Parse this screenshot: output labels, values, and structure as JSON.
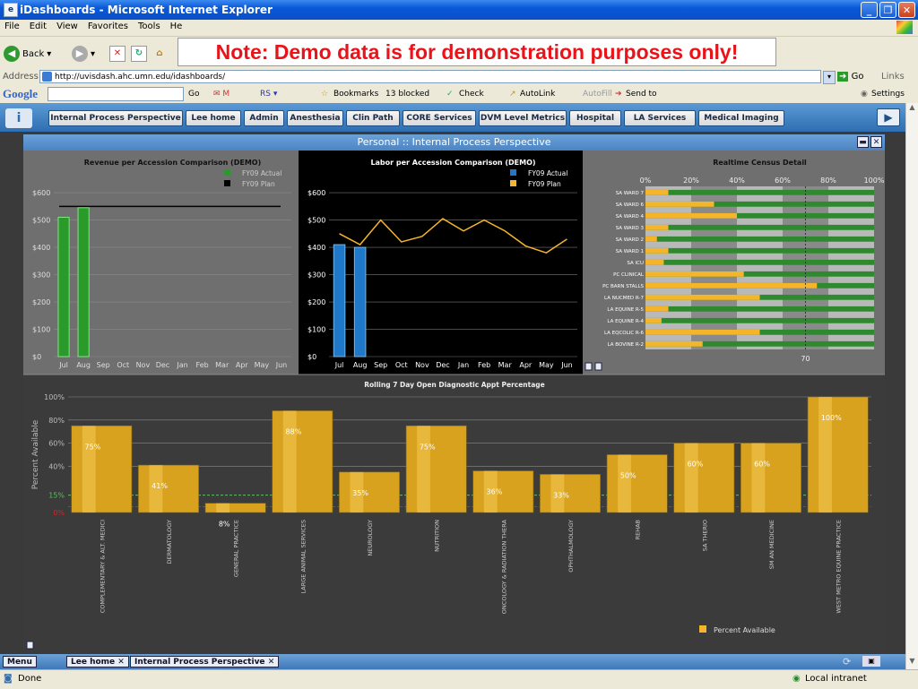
{
  "window": {
    "title": "iDashboards - Microsoft Internet Explorer"
  },
  "menu": [
    "File",
    "Edit",
    "View",
    "Favorites",
    "Tools",
    "He"
  ],
  "toolbar": {
    "back_label": "Back",
    "note": "Note: Demo data is for demonstration purposes only!"
  },
  "address": {
    "label": "Address",
    "url": "http://uvisdash.ahc.umn.edu/idashboards/",
    "go": "Go",
    "links": "Links"
  },
  "google_bar": {
    "logo": "Google",
    "go": "Go",
    "bookmarks": "Bookmarks",
    "blocked": "13 blocked",
    "check": "Check",
    "autolink": "AutoLink",
    "autofill": "AutoFill",
    "sendto": "Send to",
    "settings": "Settings"
  },
  "app_tabs": [
    "Internal Process Perspective",
    "Lee home",
    "Admin",
    "Anesthesia",
    "Clin Path",
    "CORE Services",
    "DVM Level Metrics",
    "Hospital",
    "LA Services",
    "Medical Imaging"
  ],
  "panel": {
    "title": "Personal :: Internal Process Perspective"
  },
  "bottom_tabs": {
    "menu": "Menu",
    "lee_home": "Lee home",
    "internal": "Internal Process Perspective"
  },
  "status": {
    "left": "Done",
    "right": "Local intranet"
  },
  "colors": {
    "actual_green": "#2a9a2a",
    "actual_blue": "#1f78c8",
    "plan_gold": "#f5b52a",
    "gold_bar": "#d9a21e",
    "ref_green": "#5cc05c",
    "ref_red": "#e02020"
  },
  "chart_data": [
    {
      "type": "bar",
      "title": "Revenue per Accession Comparison (DEMO)",
      "categories": [
        "Jul",
        "Aug",
        "Sep",
        "Oct",
        "Nov",
        "Dec",
        "Jan",
        "Feb",
        "Mar",
        "Apr",
        "May",
        "Jun"
      ],
      "series": [
        {
          "name": "FY09 Actual",
          "values": [
            510,
            545,
            null,
            null,
            null,
            null,
            null,
            null,
            null,
            null,
            null,
            null
          ]
        },
        {
          "name": "FY09 Plan",
          "values": [
            550,
            550,
            550,
            550,
            550,
            550,
            550,
            550,
            550,
            550,
            550,
            550
          ]
        }
      ],
      "yticks": [
        "$0",
        "$100",
        "$200",
        "$300",
        "$400",
        "$500",
        "$600"
      ],
      "ylim": [
        0,
        620
      ]
    },
    {
      "type": "bar",
      "title": "Labor per Accession Comparison (DEMO)",
      "categories": [
        "Jul",
        "Aug",
        "Sep",
        "Oct",
        "Nov",
        "Dec",
        "Jan",
        "Feb",
        "Mar",
        "Apr",
        "May",
        "Jun"
      ],
      "series": [
        {
          "name": "FY09 Actual",
          "values": [
            410,
            400,
            null,
            null,
            null,
            null,
            null,
            null,
            null,
            null,
            null,
            null
          ]
        },
        {
          "name": "FY09 Plan",
          "values": [
            450,
            410,
            500,
            420,
            440,
            505,
            460,
            500,
            460,
            405,
            380,
            430
          ]
        }
      ],
      "yticks": [
        "$0",
        "$100",
        "$200",
        "$300",
        "$400",
        "$500",
        "$600"
      ],
      "ylim": [
        0,
        620
      ]
    },
    {
      "type": "bar",
      "title": "Realtime Census Detail",
      "categories": [
        "SA WARD 7",
        "SA WARD 6",
        "SA WARD 4",
        "SA WARD 3",
        "SA WARD 2",
        "SA WARD 1",
        "SA ICU",
        "PC CLINICAL",
        "PC BARN STALLS",
        "LA NUCMED R-7",
        "LA EQUINE R-5",
        "LA EQUINE R-4",
        "LA EQCOLIC R-6",
        "LA BOVINE R-2"
      ],
      "values": [
        10,
        30,
        40,
        10,
        5,
        10,
        8,
        43,
        75,
        50,
        10,
        7,
        50,
        25
      ],
      "xticks": [
        "0%",
        "20%",
        "40%",
        "60%",
        "80%",
        "100%"
      ],
      "reference_line": {
        "value": 70,
        "label": "70"
      },
      "xlim": [
        0,
        100
      ]
    },
    {
      "type": "bar",
      "title": "Rolling 7 Day Open Diagnostic Appt Percentage",
      "ylabel": "Percent Available",
      "categories": [
        "COMPLEMENTARY & ALT. MEDICI",
        "DERMATOLOGY",
        "GENERAL PRACTICE",
        "LARGE ANIMAL SERVICES",
        "NEUROLOGY",
        "NUTRITION",
        "ONCOLOGY & RADIATION THERA",
        "OPHTHALMOLOGY",
        "REHAB",
        "SA THERIO",
        "SM AN MEDICINE",
        "WEST METRO EQUINE PRACTICE"
      ],
      "series": [
        {
          "name": "Percent Available",
          "values": [
            75,
            41,
            8,
            88,
            35,
            75,
            36,
            33,
            50,
            60,
            60,
            100
          ]
        }
      ],
      "value_labels": [
        "75%",
        "41%",
        "8%",
        "88%",
        "35%",
        "75%",
        "36%",
        "33%",
        "50%",
        "60%",
        "60%",
        "100%"
      ],
      "yticks": [
        "0%",
        "15%",
        "40%",
        "60%",
        "80%",
        "100%"
      ],
      "reference_lines": [
        {
          "value": 15,
          "label": "15%"
        },
        {
          "value": 5,
          "label": "5%"
        }
      ],
      "ylim": [
        0,
        100
      ]
    }
  ]
}
